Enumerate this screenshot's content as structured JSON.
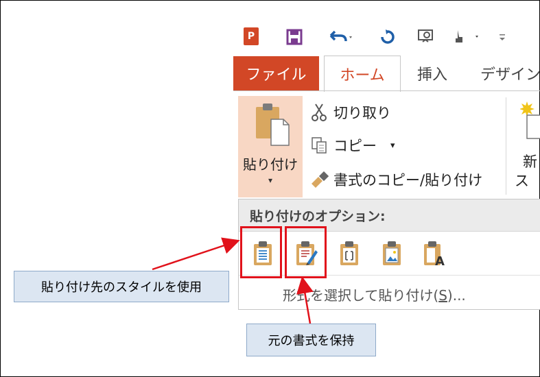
{
  "app": {
    "logo_text": "P"
  },
  "qat": {
    "icons": [
      "powerpoint-logo",
      "save-icon",
      "undo-icon",
      "redo-icon",
      "present-from-start-icon",
      "touch-mode-icon",
      "customize-qat-icon"
    ]
  },
  "tabs": {
    "file": "ファイル",
    "home": "ホーム",
    "insert": "挿入",
    "design": "デザイン"
  },
  "clipboard": {
    "paste_label": "貼り付け",
    "paste_caret": "▾",
    "cut": "切り取り",
    "copy": "コピー",
    "copy_caret": "▾",
    "format_painter": "書式のコピー/貼り付け"
  },
  "slides": {
    "new_line1": "新",
    "new_line2": "ス"
  },
  "paste_menu": {
    "title": "貼り付けのオプション:",
    "options": [
      "use-destination-theme",
      "keep-source-formatting",
      "embed",
      "picture",
      "keep-text-only"
    ],
    "special_prefix": "形式を選択して貼り付け(",
    "special_key": "S",
    "special_suffix": ")..."
  },
  "annotations": {
    "left_callout": "貼り付け先のスタイルを使用",
    "bottom_callout": "元の書式を保持"
  },
  "colors": {
    "accent": "#d24726",
    "highlight": "#e1121b",
    "callout_bg": "#dce6f2"
  }
}
